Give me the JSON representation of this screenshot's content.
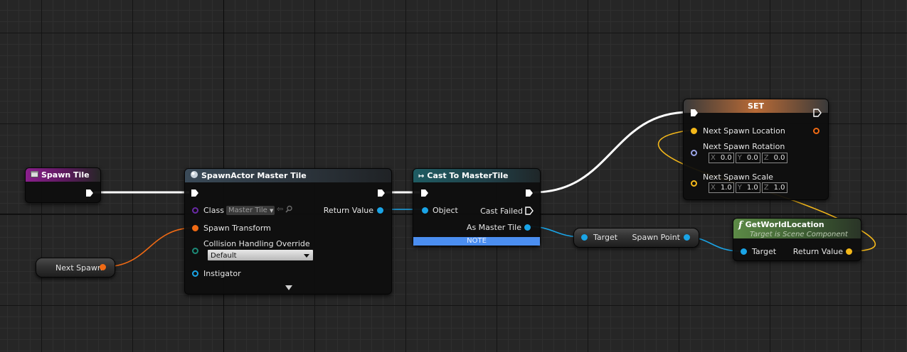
{
  "nodes": {
    "spawn_tile": {
      "title": "Spawn Tile"
    },
    "spawn_actor": {
      "title": "SpawnActor Master Tile",
      "class_label": "Class",
      "class_value": "Master Tile",
      "return_label": "Return Value",
      "spawn_transform_label": "Spawn Transform",
      "collision_label": "Collision Handling Override",
      "collision_value": "Default",
      "instigator_label": "Instigator"
    },
    "cast": {
      "title": "Cast To MasterTile",
      "object_label": "Object",
      "cast_failed_label": "Cast Failed",
      "as_master_tile_label": "As Master Tile",
      "note_label": "NOTE"
    },
    "set": {
      "title": "SET",
      "next_spawn_location_label": "Next Spawn Location",
      "next_spawn_rotation_label": "Next Spawn Rotation",
      "rotation": {
        "x": "0.0",
        "y": "0.0",
        "z": "0.0"
      },
      "next_spawn_scale_label": "Next Spawn Scale",
      "scale": {
        "x": "1.0",
        "y": "1.0",
        "z": "1.0"
      }
    },
    "next_spawn": {
      "label": "Next Spawn"
    },
    "spawn_point": {
      "target_label": "Target",
      "output_label": "Spawn Point"
    },
    "get_world_location": {
      "title": "GetWorldLocation",
      "subtitle": "Target is Scene Component",
      "target_label": "Target",
      "return_label": "Return Value"
    }
  },
  "axis_labels": {
    "x": "X",
    "y": "Y",
    "z": "Z"
  },
  "colors": {
    "exec_wire": "#ffffff",
    "transform_wire": "#f06a14",
    "object_wire": "#1aa4e6",
    "vector_wire": "#f4b81a"
  },
  "icons": {
    "event": "event-icon",
    "spawn_actor": "sphere-icon",
    "cast": "cast-arrow-icon",
    "function": "function-icon",
    "class_browse": "arrow-left-icon",
    "class_search": "magnifier-icon",
    "expand": "chevron-down-icon"
  }
}
